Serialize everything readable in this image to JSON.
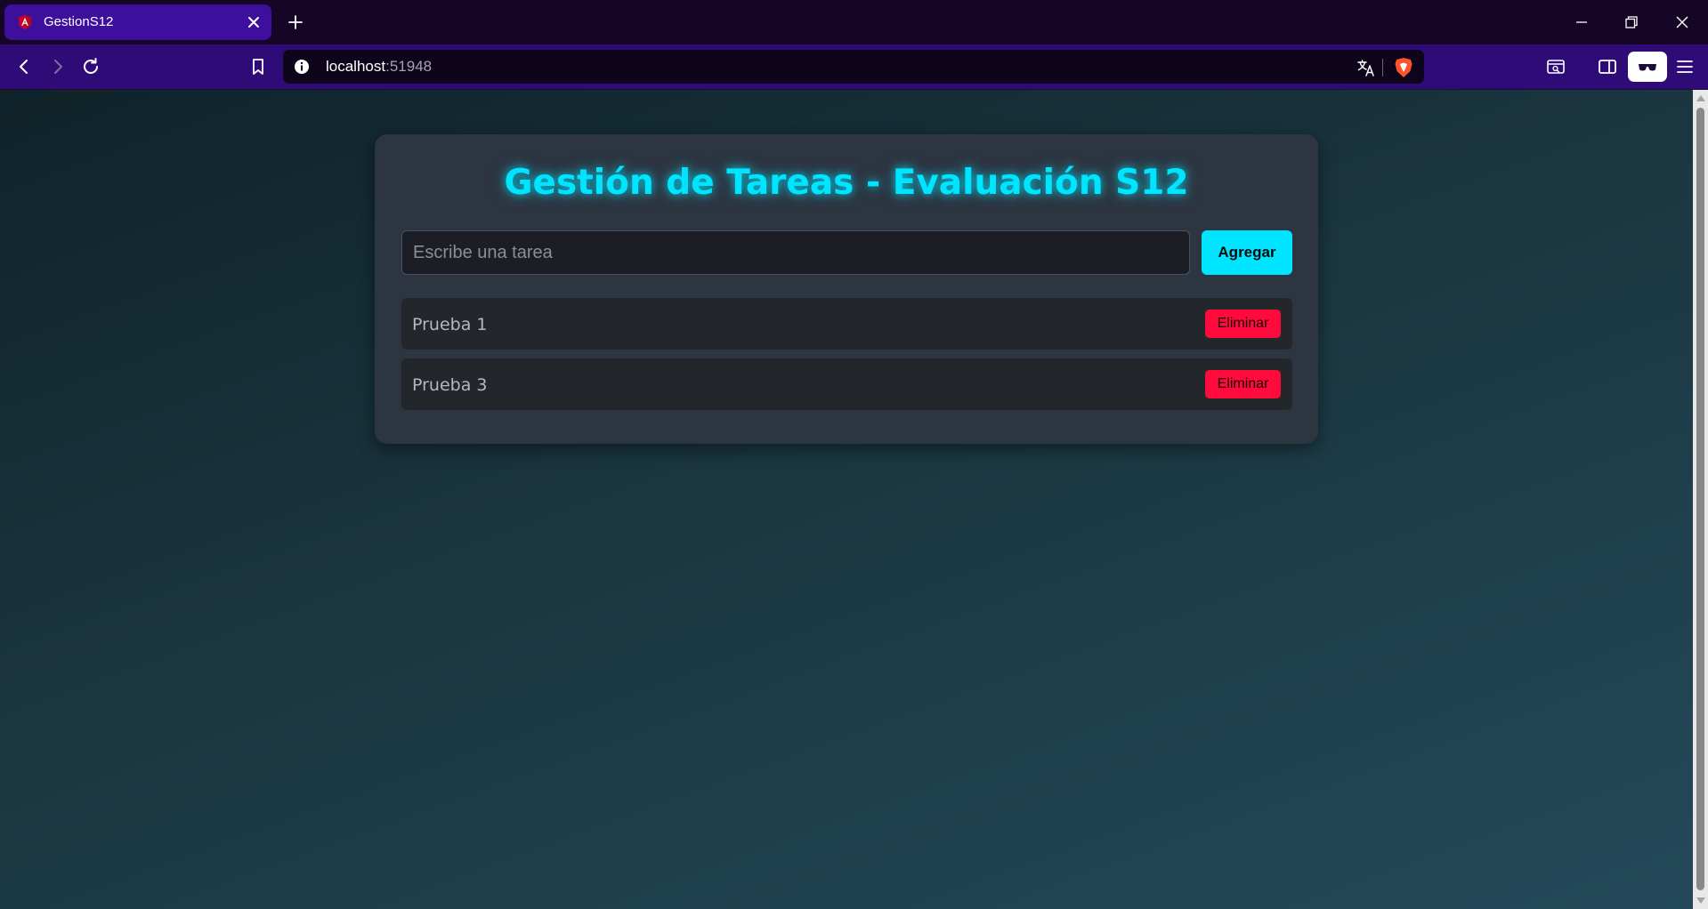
{
  "browser": {
    "tab": {
      "title": "GestionS12",
      "favicon": "angular-icon"
    },
    "toolbar": {
      "url_host": "localhost",
      "url_port": ":51948"
    },
    "colors": {
      "tabstrip": "#150626",
      "toolbar": "#2f0b78",
      "active_tab": "#3d0f9c"
    }
  },
  "app": {
    "title": "Gestión de Tareas - Evaluación S12",
    "input": {
      "placeholder": "Escribe una tarea",
      "value": ""
    },
    "add_label": "Agregar",
    "tasks": [
      {
        "text": "Prueba 1",
        "delete_label": "Eliminar"
      },
      {
        "text": "Prueba 3",
        "delete_label": "Eliminar"
      }
    ],
    "colors": {
      "accent": "#00e5ff",
      "danger": "#ff0a3c",
      "card": "#2d3541"
    }
  }
}
